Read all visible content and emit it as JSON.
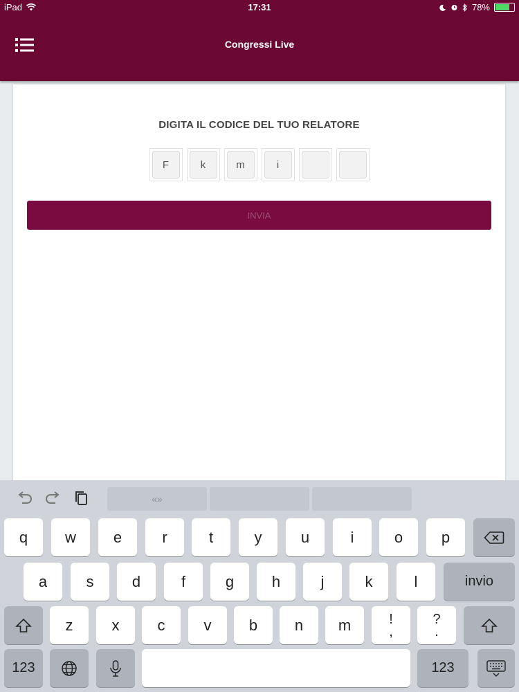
{
  "status_bar": {
    "device": "iPad",
    "time": "17:31",
    "battery": "78%",
    "battery_level_percent": 78,
    "icons": [
      "wifi-icon",
      "moon-icon",
      "alarm-icon",
      "bluetooth-icon",
      "battery-icon"
    ]
  },
  "header": {
    "title": "Congressi Live",
    "menu_icon": "hamburger-menu-icon",
    "background_color": "#6b0733"
  },
  "form": {
    "prompt": "DIGITA IL CODICE DEL TUO RELATORE",
    "code_chars": [
      "F",
      "k",
      "m",
      "i",
      "",
      ""
    ],
    "submit_label": "INVIA",
    "button_color": "#7a0b41"
  },
  "keyboard": {
    "toolbar": {
      "icons": [
        "undo-icon",
        "redo-icon",
        "paste-icon"
      ],
      "suggestions": [
        "«»",
        "",
        ""
      ]
    },
    "row1": [
      "q",
      "w",
      "e",
      "r",
      "t",
      "y",
      "u",
      "i",
      "o",
      "p"
    ],
    "row2": [
      "a",
      "s",
      "d",
      "f",
      "g",
      "h",
      "j",
      "k",
      "l"
    ],
    "row3": [
      "z",
      "x",
      "c",
      "v",
      "b",
      "n",
      "m"
    ],
    "punct1": [
      "!",
      ","
    ],
    "punct2": [
      "?",
      "."
    ],
    "return_label": "invio",
    "numbers_label": "123",
    "icons": [
      "backspace-icon",
      "shift-icon",
      "globe-icon",
      "microphone-icon",
      "keyboard-dismiss-icon"
    ]
  }
}
